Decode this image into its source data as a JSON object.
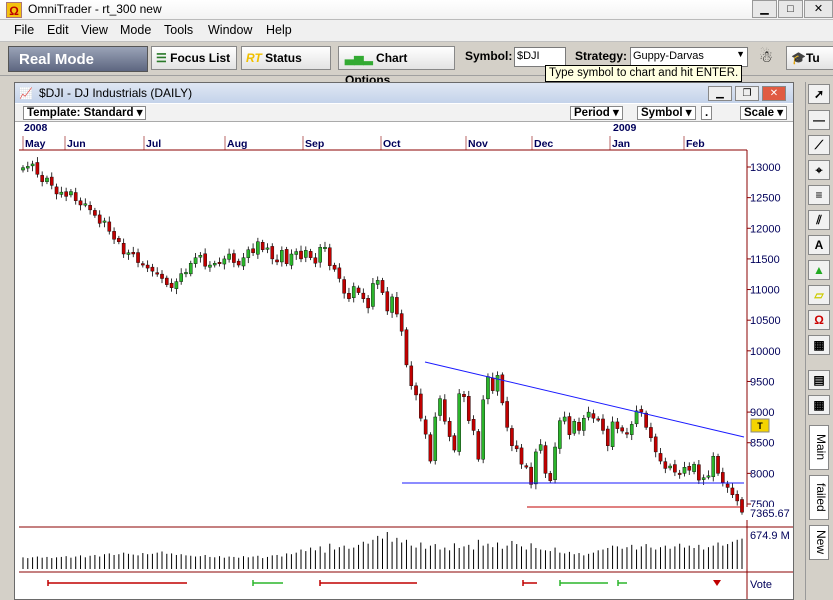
{
  "app": {
    "title": "OmniTrader - rt_300 new",
    "icon": "omnitrader-logo-icon"
  },
  "menu": [
    "File",
    "Edit",
    "View",
    "Mode",
    "Tools",
    "Window",
    "Help"
  ],
  "toolbar": {
    "mode": "Real Mode",
    "focus_list": "Focus List",
    "rt_prefix": "RT",
    "status": "Status",
    "chart_options": "Chart Options",
    "symbol_label": "Symbol:",
    "symbol_value": "$DJI",
    "strategy_label": "Strategy:",
    "strategy_value": "Guppy-Darvas",
    "more_label": "Tu"
  },
  "tooltip": "Type symbol to chart and hit ENTER.",
  "chart_window": {
    "title": "$DJI - DJ Industrials (DAILY)",
    "template": "Template: Standard",
    "period": "Period",
    "symbol_menu": "Symbol",
    "dot": ".",
    "scale": "Scale"
  },
  "side_tabs": [
    "Main",
    "failed",
    "New"
  ],
  "colors": {
    "up": "#2bb52b",
    "down": "#c00000",
    "trendline": "#1a1aff",
    "frame": "#8b0000",
    "axis_text": "#00005a"
  },
  "chart_data": {
    "type": "candlestick",
    "title": "$DJI - DJ Industrials (DAILY)",
    "years": [
      {
        "label": "2008",
        "month": "May"
      },
      {
        "label": "2009",
        "month": "Jan"
      }
    ],
    "months": [
      "May",
      "Jun",
      "Jul",
      "Aug",
      "Sep",
      "Oct",
      "Nov",
      "Dec",
      "Jan",
      "Feb"
    ],
    "yticks": [
      13000,
      12500,
      12000,
      11500,
      11000,
      10500,
      10000,
      9500,
      9000,
      8500,
      8000,
      7500
    ],
    "ylim": [
      7250,
      13250
    ],
    "last_price": "7365.67",
    "volume_label": "674.9 M",
    "vote_label": "Vote",
    "closes": [
      12990,
      13010,
      13050,
      12880,
      12760,
      12820,
      12700,
      12560,
      12590,
      12520,
      12600,
      12450,
      12380,
      12400,
      12300,
      12210,
      12080,
      12120,
      11950,
      11820,
      11780,
      11580,
      11600,
      11580,
      11440,
      11400,
      11350,
      11300,
      11260,
      11180,
      11080,
      11030,
      11130,
      11260,
      11280,
      11430,
      11520,
      11560,
      11380,
      11400,
      11430,
      11440,
      11500,
      11580,
      11440,
      11400,
      11520,
      11650,
      11600,
      11780,
      11650,
      11680,
      11500,
      11450,
      11640,
      11420,
      11580,
      11620,
      11500,
      11640,
      11520,
      11430,
      11690,
      11690,
      11390,
      11330,
      11180,
      10940,
      10850,
      11050,
      10950,
      10850,
      10700,
      11100,
      11150,
      10950,
      10650,
      10880,
      10600,
      10320,
      9770,
      9430,
      9280,
      8900,
      8640,
      8200,
      8920,
      9220,
      8850,
      8600,
      8380,
      9300,
      9250,
      8860,
      8700,
      8230,
      9200,
      9580,
      9350,
      9600,
      9150,
      8750,
      8450,
      8400,
      8150,
      8110,
      7820,
      8350,
      8470,
      8000,
      7880,
      8430,
      8860,
      8920,
      8630,
      8850,
      8700,
      8900,
      9000,
      8900,
      8880,
      8700,
      8450,
      8840,
      8730,
      8690,
      8640,
      8800,
      9020,
      9000,
      8750,
      8580,
      8350,
      8200,
      8080,
      8120,
      8020,
      8000,
      8100,
      8050,
      8150,
      7890,
      7930,
      7960,
      8280,
      8000,
      7850,
      7770,
      7650,
      7550,
      7365
    ],
    "volumes": [
      3.0,
      2.8,
      3.0,
      3.2,
      2.9,
      3.1,
      2.8,
      3.0,
      3.1,
      3.3,
      2.9,
      3.2,
      3.5,
      3.0,
      3.4,
      3.6,
      3.2,
      3.8,
      4.0,
      3.6,
      3.8,
      4.2,
      3.9,
      3.7,
      3.5,
      4.1,
      3.8,
      3.9,
      4.2,
      4.5,
      3.9,
      4.0,
      3.6,
      3.8,
      3.5,
      3.4,
      3.2,
      3.3,
      3.6,
      3.1,
      3.0,
      3.3,
      2.9,
      3.2,
      3.1,
      2.9,
      3.3,
      3.0,
      3.2,
      3.4,
      2.8,
      3.1,
      3.5,
      3.6,
      3.2,
      4.0,
      3.8,
      4.2,
      5.0,
      4.6,
      5.5,
      4.8,
      5.8,
      4.2,
      6.5,
      5.0,
      5.6,
      6.0,
      5.2,
      5.5,
      6.2,
      7.0,
      6.5,
      7.5,
      8.5,
      7.8,
      9.5,
      7.0,
      8.0,
      6.8,
      7.5,
      6.0,
      5.5,
      6.8,
      5.2,
      6.0,
      6.4,
      5.0,
      5.5,
      4.8,
      6.6,
      5.4,
      5.8,
      6.2,
      5.0,
      7.5,
      6.0,
      6.5,
      5.6,
      6.8,
      5.2,
      6.0,
      7.2,
      6.4,
      5.8,
      5.0,
      6.6,
      5.4,
      5.0,
      4.8,
      4.6,
      5.5,
      4.2,
      4.0,
      4.4,
      3.8,
      4.1,
      3.5,
      3.9,
      4.2,
      4.8,
      5.0,
      5.4,
      6.0,
      5.8,
      5.2,
      5.6,
      6.2,
      5.0,
      5.8,
      6.4,
      5.5,
      5.0,
      5.6,
      6.0,
      5.2,
      5.8,
      6.5,
      5.5,
      6.0,
      5.4,
      6.2,
      5.0,
      5.6,
      6.0,
      6.8,
      6.0,
      6.4,
      7.0,
      7.5,
      7.8
    ]
  }
}
